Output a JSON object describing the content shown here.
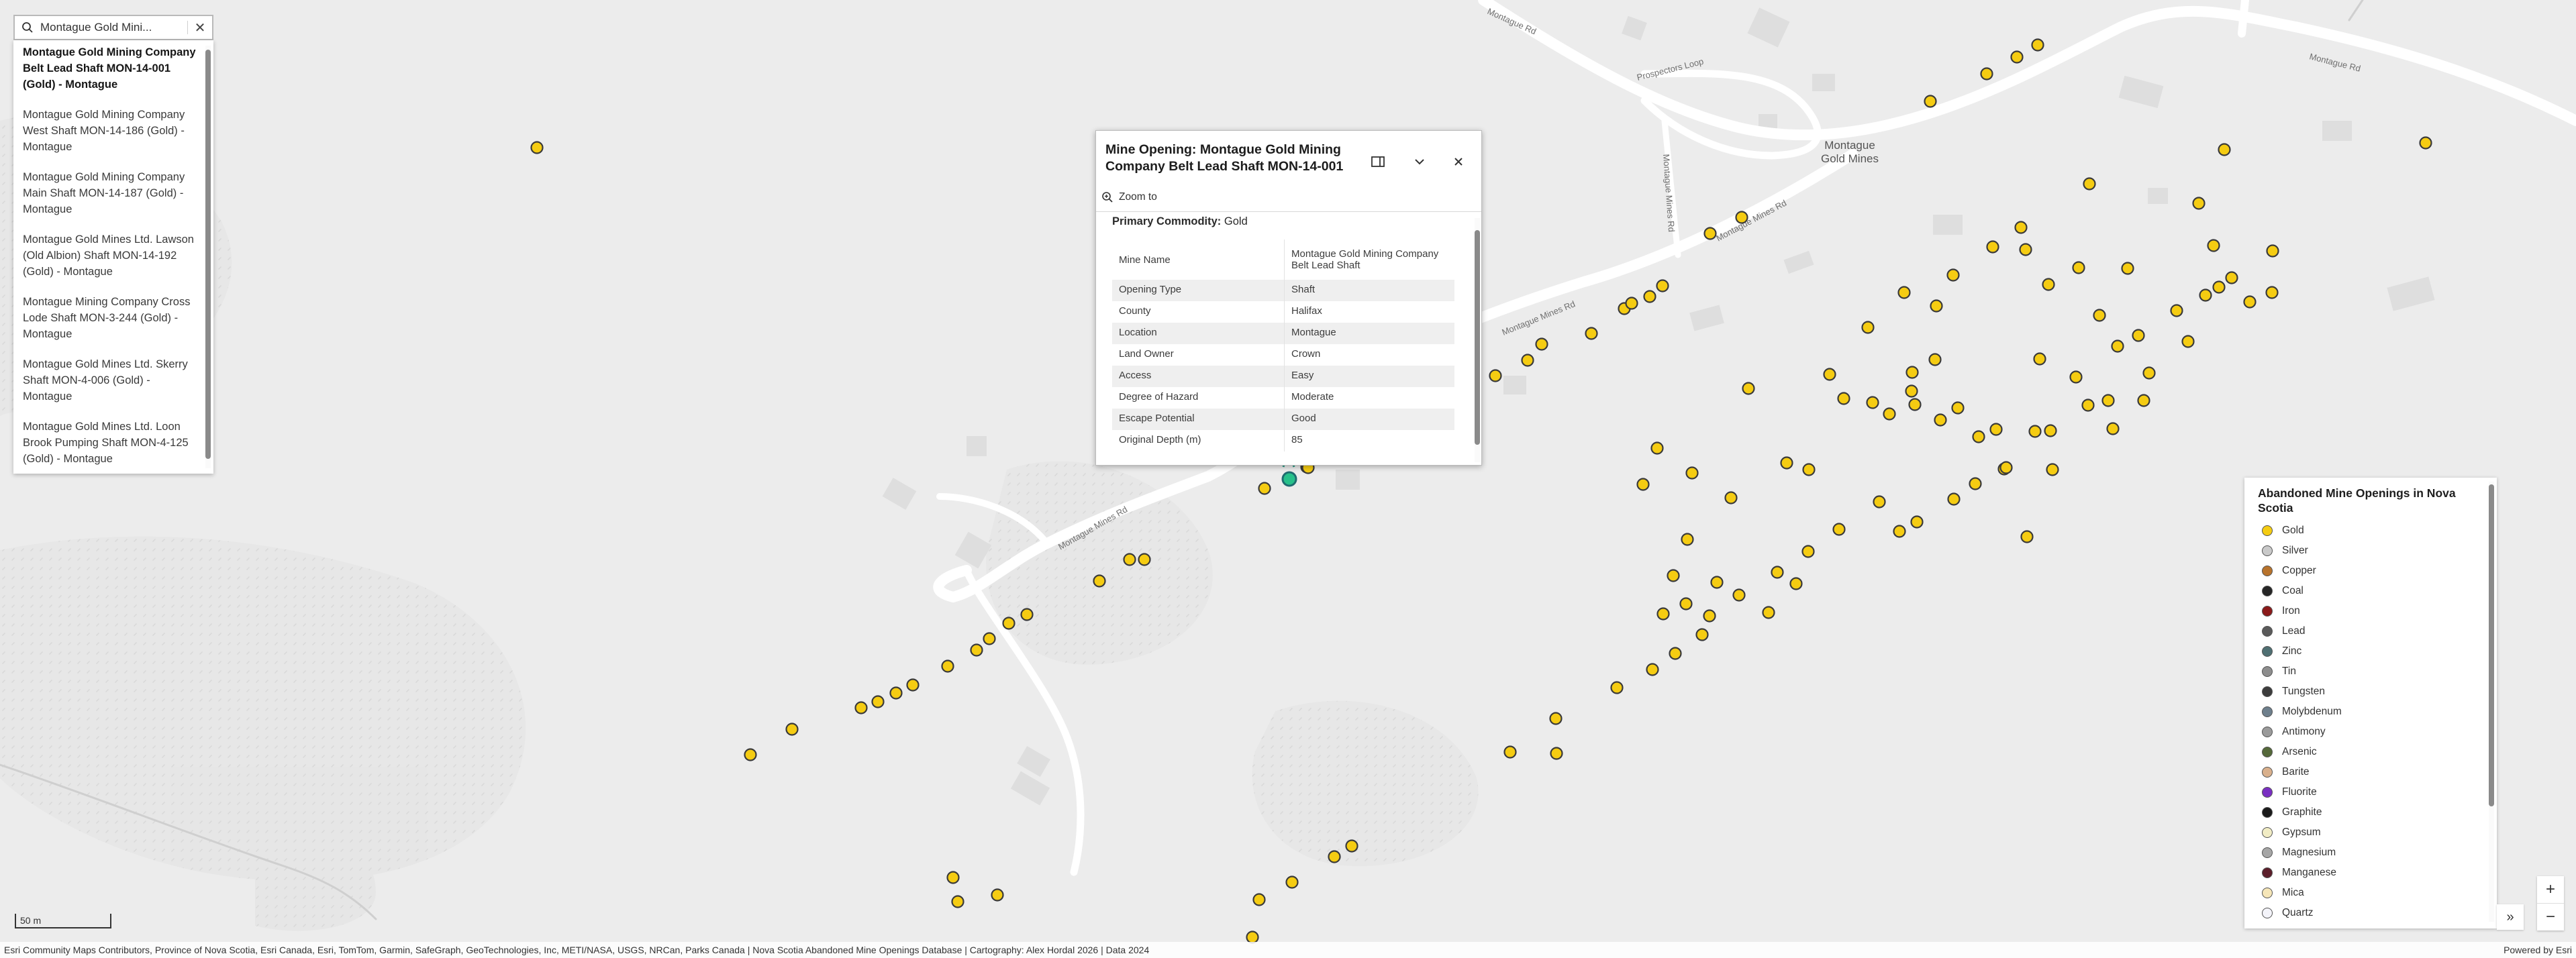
{
  "search": {
    "value": "Montague Gold Mini..."
  },
  "suggestions": [
    {
      "label": "Montague Gold Mining Company Belt Lead Shaft MON-14-001 (Gold) - Montague",
      "selected": true
    },
    {
      "label": "Montague Gold Mining Company West Shaft MON-14-186 (Gold) - Montague",
      "selected": false
    },
    {
      "label": "Montague Gold Mining Company Main Shaft MON-14-187 (Gold) - Montague",
      "selected": false
    },
    {
      "label": "Montague Gold Mines Ltd. Lawson (Old Albion) Shaft MON-14-192 (Gold) - Montague",
      "selected": false
    },
    {
      "label": "Montague Mining Company Cross Lode Shaft MON-3-244 (Gold) - Montague",
      "selected": false
    },
    {
      "label": "Montague Gold Mines Ltd. Skerry Shaft MON-4-006 (Gold) - Montague",
      "selected": false
    },
    {
      "label": "Montague Gold Mines Ltd. Loon Brook Pumping Shaft MON-4-125 (Gold) - Montague",
      "selected": false
    }
  ],
  "popup": {
    "title": "Mine Opening: Montague Gold Mining Company Belt Lead Shaft MON-14-001",
    "zoom_to": "Zoom to",
    "commodity_label": "Primary Commodity:",
    "commodity_value": "Gold",
    "fields": [
      {
        "label": "Mine Name",
        "value": "Montague Gold Mining Company Belt Lead Shaft"
      },
      {
        "label": "Opening Type",
        "value": "Shaft"
      },
      {
        "label": "County",
        "value": "Halifax"
      },
      {
        "label": "Location",
        "value": "Montague"
      },
      {
        "label": "Land Owner",
        "value": "Crown"
      },
      {
        "label": "Access",
        "value": "Easy"
      },
      {
        "label": "Degree of Hazard",
        "value": "Moderate"
      },
      {
        "label": "Escape Potential",
        "value": "Good"
      },
      {
        "label": "Original Depth (m)",
        "value": "85"
      }
    ]
  },
  "map": {
    "place_label": "Montague\nGold Mines",
    "road_labels": [
      "Montague Rd",
      "Montague Rd",
      "Prospectors Loop",
      "Montague Mines Rd",
      "Montague Mines Rd",
      "Montague Mines Rd",
      "Montague Mines Rd"
    ],
    "scale_label": "50 m",
    "selected_color": "#27c08a",
    "point_color": "#f5cc12"
  },
  "legend": {
    "title": "Abandoned Mine Openings in Nova Scotia",
    "items": [
      {
        "label": "Gold",
        "color": "#f5cc12"
      },
      {
        "label": "Silver",
        "color": "#c9c9c9"
      },
      {
        "label": "Copper",
        "color": "#b8732c"
      },
      {
        "label": "Coal",
        "color": "#262626"
      },
      {
        "label": "Iron",
        "color": "#8b1a1a"
      },
      {
        "label": "Lead",
        "color": "#5a5a5a"
      },
      {
        "label": "Zinc",
        "color": "#4f6f72"
      },
      {
        "label": "Tin",
        "color": "#8d8d8d"
      },
      {
        "label": "Tungsten",
        "color": "#3c3c3c"
      },
      {
        "label": "Molybdenum",
        "color": "#6e7f8c"
      },
      {
        "label": "Antimony",
        "color": "#9a9a9a"
      },
      {
        "label": "Arsenic",
        "color": "#55693a"
      },
      {
        "label": "Barite",
        "color": "#d9b08c"
      },
      {
        "label": "Fluorite",
        "color": "#7a2fc2"
      },
      {
        "label": "Graphite",
        "color": "#1a1a1a"
      },
      {
        "label": "Gypsum",
        "color": "#f1ecc4"
      },
      {
        "label": "Magnesium",
        "color": "#a6a6a6"
      },
      {
        "label": "Manganese",
        "color": "#5c1f2b"
      },
      {
        "label": "Mica",
        "color": "#f6e6b8"
      },
      {
        "label": "Quartz",
        "color": "#f4f4fa"
      }
    ]
  },
  "attribution": {
    "left": "Esri Community Maps Contributors, Province of Nova Scotia, Esri Canada, Esri, TomTom, Garmin, SafeGraph, GeoTechnologies, Inc, METI/NASA, USGS, NRCan, Parks Canada | Nova Scotia Abandoned Mine Openings Database | Cartography: Alex Hordal 2026 | Data 2024",
    "right": "Powered by Esri"
  }
}
